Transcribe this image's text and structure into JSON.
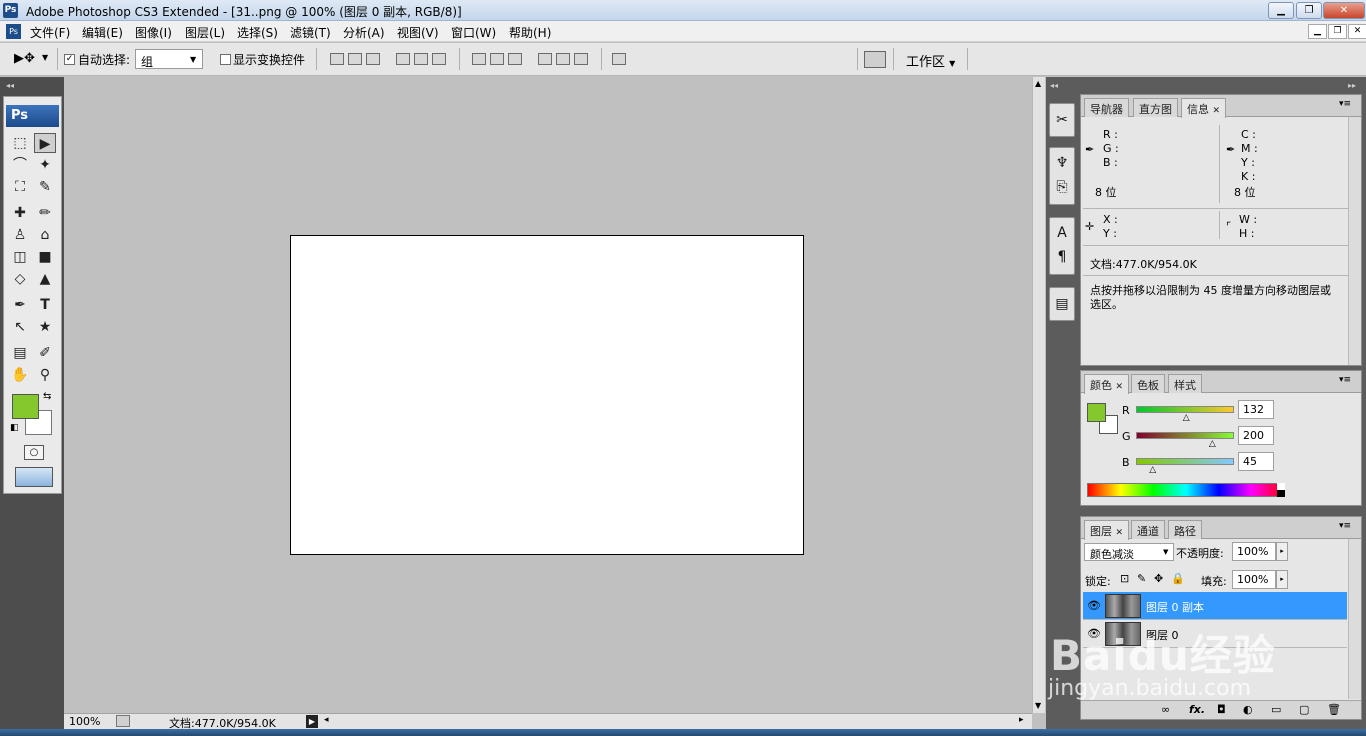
{
  "window": {
    "app_icon": "Ps",
    "title": "Adobe Photoshop CS3 Extended - [31..png @ 100% (图层 0 副本, RGB/8)]",
    "min_glyph": "▁",
    "restore_glyph": "❐",
    "close_glyph": "✕"
  },
  "menu": {
    "items": [
      "文件(F)",
      "编辑(E)",
      "图像(I)",
      "图层(L)",
      "选择(S)",
      "滤镜(T)",
      "分析(A)",
      "视图(V)",
      "窗口(W)",
      "帮助(H)"
    ],
    "doc_min": "▁",
    "doc_restore": "❐",
    "doc_close": "✕"
  },
  "options_bar": {
    "move_tool_glyph": "▶✥",
    "auto_select_label": "自动选择:",
    "auto_select_checked": "✓",
    "auto_select_value": "组",
    "show_transform_label": "显示变换控件",
    "workspace_label": "工作区"
  },
  "toolbox": {
    "header": "Ps",
    "tools": [
      "⬚",
      "▶",
      "⌒",
      "✦",
      "⛶",
      "✎",
      "✚",
      "✏",
      "♙",
      "⌂",
      "◫",
      "■",
      "◇",
      "▲",
      "✒",
      "T",
      "↖",
      "★",
      "▤",
      "✐",
      "✋",
      "⚲"
    ],
    "fg_color": "#84c82d",
    "bg_color": "#ffffff"
  },
  "statusbar": {
    "zoom": "100%",
    "doc_info": "文档:477.0K/954.0K"
  },
  "info_panel": {
    "tabs": [
      "导航器",
      "直方图",
      "信息"
    ],
    "left_channels": [
      "R :",
      "G :",
      "B :"
    ],
    "right_channels": [
      "C :",
      "M :",
      "Y :",
      "K :"
    ],
    "bit_left": "8 位",
    "bit_right": "8 位",
    "xy": [
      "X :",
      "Y :"
    ],
    "wh": [
      "W :",
      "H :"
    ],
    "doc_size": "文档:477.0K/954.0K",
    "hint": "点按并拖移以沿限制为 45 度增量方向移动图层或选区。"
  },
  "color_panel": {
    "tabs": [
      "颜色",
      "色板",
      "样式"
    ],
    "channels": [
      {
        "label": "R",
        "value": "132",
        "level": 0.518
      },
      {
        "label": "G",
        "value": "200",
        "level": 0.784
      },
      {
        "label": "B",
        "value": "45",
        "level": 0.176
      }
    ],
    "swatch": "#84c82d"
  },
  "layers_panel": {
    "tabs": [
      "图层",
      "通道",
      "路径"
    ],
    "blend_mode": "颜色减淡",
    "opacity_label": "不透明度:",
    "opacity": "100%",
    "lock_label": "锁定:",
    "fill_label": "填充:",
    "fill": "100%",
    "layers": [
      {
        "name": "图层 0 副本",
        "selected": true
      },
      {
        "name": "图层 0",
        "selected": false
      }
    ],
    "footer_icons": [
      "∞",
      "fx.",
      "◘",
      "◐",
      "▭",
      "▢",
      "🗑"
    ]
  },
  "watermark": {
    "brand": "Baidu经验",
    "url": "jingyan.baidu.com"
  },
  "colors": {
    "selected_layer": "#3399ff",
    "titlebar": "#c4d6ec"
  }
}
